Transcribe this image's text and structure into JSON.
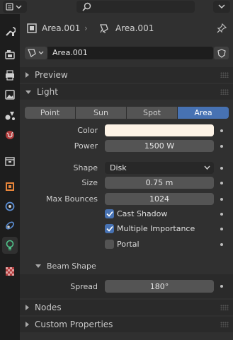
{
  "header": {
    "object_name": "Area.001",
    "data_name": "Area.001"
  },
  "datablock": {
    "name": "Area.001"
  },
  "sections": {
    "preview": "Preview",
    "light": "Light",
    "beam_shape": "Beam Shape",
    "nodes": "Nodes",
    "custom_properties": "Custom Properties"
  },
  "light_types": [
    "Point",
    "Sun",
    "Spot",
    "Area"
  ],
  "selected_light_type": "Area",
  "props": {
    "color_label": "Color",
    "color_value": "#fdf3e6",
    "power_label": "Power",
    "power_value": "1500 W",
    "shape_label": "Shape",
    "shape_value": "Disk",
    "size_label": "Size",
    "size_value": "0.75 m",
    "max_bounces_label": "Max Bounces",
    "max_bounces_value": "1024",
    "spread_label": "Spread",
    "spread_value": "180°"
  },
  "checkboxes": [
    {
      "label": "Cast Shadow",
      "checked": true
    },
    {
      "label": "Multiple Importance",
      "checked": true
    },
    {
      "label": "Portal",
      "checked": false
    }
  ],
  "colors": {
    "accent": "#4772b3",
    "panel_bg": "#303030",
    "field_bg": "#545454"
  }
}
